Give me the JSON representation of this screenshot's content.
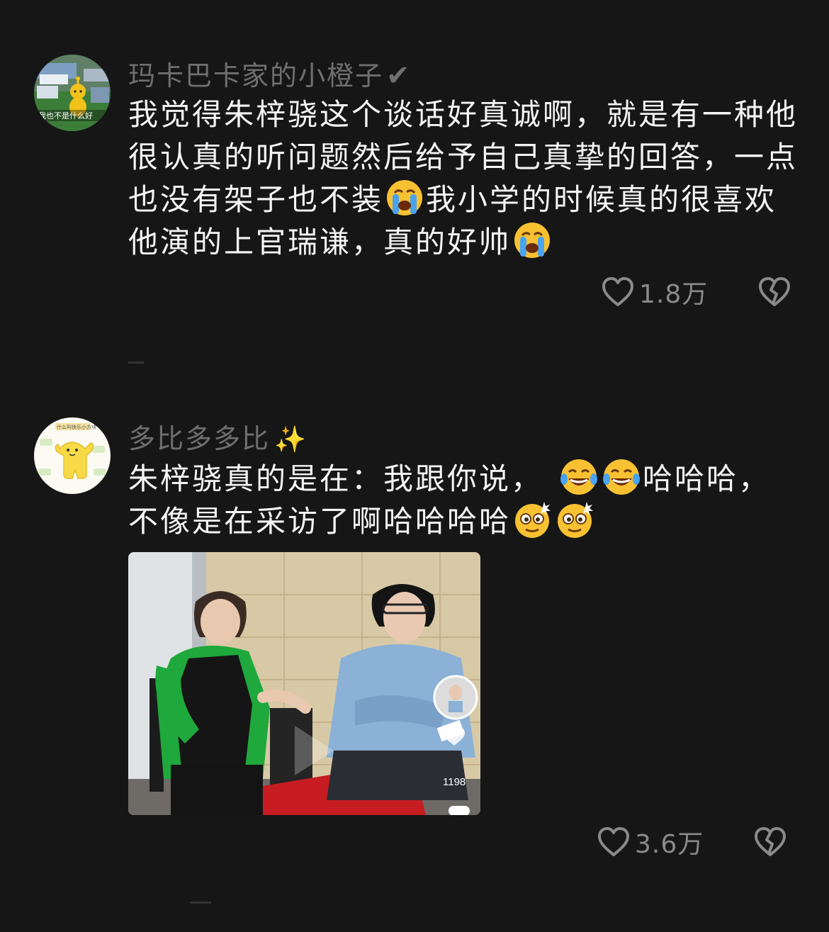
{
  "comments": [
    {
      "username": "玛卡巴卡家的小橙子",
      "badge": "✔",
      "avatar_caption": "我也不是什么好",
      "text_a": "我觉得朱梓骁这个谈话好真诚啊，就是有一种他很认真的听问题然后给予自己真挚的回答，一点也没有架子也不装",
      "text_b": "我小学的时候真的很喜欢他演的上官瑞谦，真的好帅",
      "likes": "1.8万"
    },
    {
      "username": "多比多多比",
      "badge": "✨",
      "avatar_caption": "什么叫快乐小方块",
      "text_a": "朱梓骁真的是在：我跟你说，",
      "text_b": "哈哈哈，不像是在采访了啊哈哈哈哈",
      "image_overlay_count": "1198",
      "likes": "3.6万"
    }
  ],
  "icons": {
    "like": "heart-outline-icon",
    "dislike": "broken-heart-icon",
    "verified": "check-icon",
    "sparkle": "sparkles-icon",
    "crying": "loudly-crying-face-emoji",
    "laughing": "tears-of-joy-emoji",
    "dizzy": "dizzy-face-emoji"
  },
  "colors": {
    "background": "#161616",
    "username": "#6f6f6f",
    "text": "#f4f4f4",
    "icon": "#8a8a8a"
  }
}
